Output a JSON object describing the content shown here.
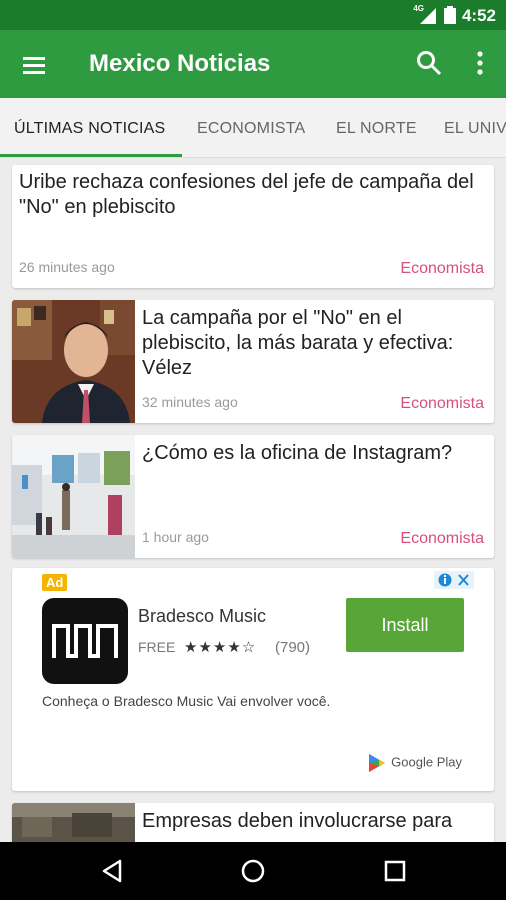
{
  "status_bar": {
    "network": "4G",
    "time": "4:52"
  },
  "app_bar": {
    "title": "Mexico Noticias",
    "icons": [
      "menu-icon",
      "search-icon",
      "more-vert-icon"
    ]
  },
  "tabs": [
    {
      "label": "ÚLTIMAS NOTICIAS",
      "active": true
    },
    {
      "label": "ECONOMISTA",
      "active": false
    },
    {
      "label": "EL NORTE",
      "active": false
    },
    {
      "label": "EL UNIVERSAL",
      "active": false
    }
  ],
  "articles": [
    {
      "headline": "Uribe rechaza confesiones del jefe de campaña del \"No\" en plebiscito",
      "time": "26 minutes ago",
      "source": "Economista",
      "has_image": false
    },
    {
      "headline": "La campaña por el \"No\" en el plebiscito, la más barata y efectiva: Vélez",
      "time": "32 minutes ago",
      "source": "Economista",
      "has_image": true
    },
    {
      "headline": "¿Cómo es la oficina de Instagram?",
      "time": "1 hour ago",
      "source": "Economista",
      "has_image": true
    },
    {
      "headline": "Empresas deben involucrarse para",
      "time": "",
      "source": "",
      "has_image": true
    }
  ],
  "ad": {
    "badge": "Ad",
    "app_name": "Bradesco Music",
    "price": "FREE",
    "rating": 4,
    "rating_count": "(790)",
    "install_label": "Install",
    "description": "Conheça o Bradesco Music Vai envolver você.",
    "store_label": "Google Play"
  },
  "colors": {
    "status_bar": "#1b7c2c",
    "app_bar": "#2f9b40",
    "source_text": "#d6507a",
    "install": "#57a637"
  }
}
